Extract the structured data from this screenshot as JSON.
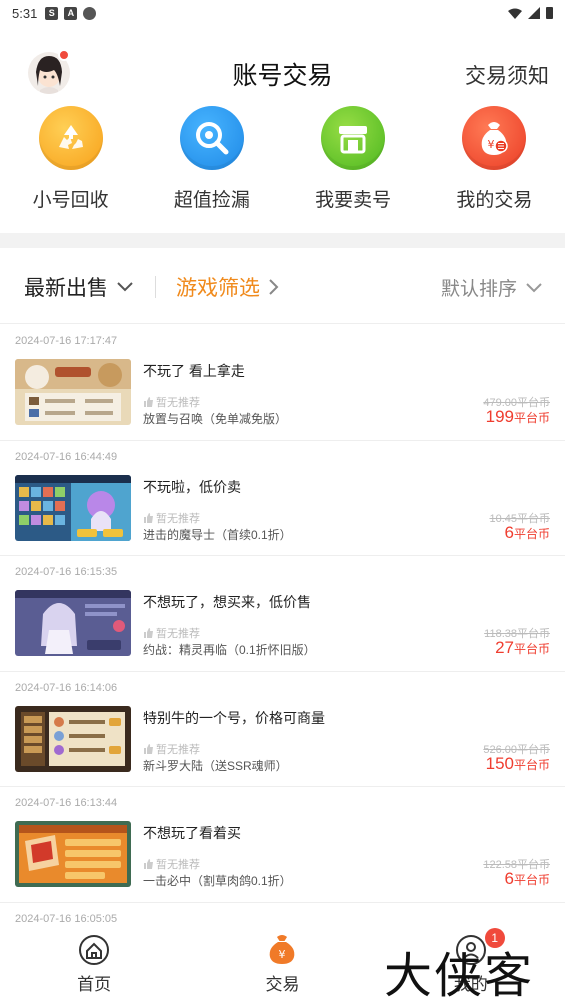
{
  "status_bar": {
    "time": "5:31",
    "icons": [
      "s-app-icon",
      "a-app-icon",
      "circle-icon"
    ],
    "right_icons": [
      "wifi-icon",
      "signal-icon",
      "battery-icon"
    ]
  },
  "header": {
    "title": "账号交易",
    "notice_link": "交易须知"
  },
  "quick_menu": [
    {
      "label": "小号回收",
      "icon": "recycle-icon",
      "color": "#f7a019"
    },
    {
      "label": "超值捡漏",
      "icon": "search-icon",
      "color": "#1e88e5"
    },
    {
      "label": "我要卖号",
      "icon": "shop-icon",
      "color": "#4cb71f"
    },
    {
      "label": "我的交易",
      "icon": "money-bag-icon",
      "color": "#ea3b24"
    }
  ],
  "filters": {
    "latest": "最新出售",
    "game_filter": "游戏筛选",
    "sort": "默认排序"
  },
  "listings": [
    {
      "time": "2024-07-16 17:17:47",
      "title": "不玩了 看上拿走",
      "no_recommend": "暂无推荐",
      "game": "放置与召唤（免单减免版）",
      "original_price": "479.00平台币",
      "price": "199",
      "unit": "平台币"
    },
    {
      "time": "2024-07-16 16:44:49",
      "title": "不玩啦，低价卖",
      "no_recommend": "暂无推荐",
      "game": "进击的魔导士（首续0.1折）",
      "original_price": "10.45平台币",
      "price": "6",
      "unit": "平台币"
    },
    {
      "time": "2024-07-16 16:15:35",
      "title": "不想玩了，想买来，低价售",
      "no_recommend": "暂无推荐",
      "game": "约战：精灵再临（0.1折怀旧版）",
      "original_price": "118.38平台币",
      "price": "27",
      "unit": "平台币"
    },
    {
      "time": "2024-07-16 16:14:06",
      "title": "特别牛的一个号，价格可商量",
      "no_recommend": "暂无推荐",
      "game": "新斗罗大陆（送SSR魂师）",
      "original_price": "526.00平台币",
      "price": "150",
      "unit": "平台币"
    },
    {
      "time": "2024-07-16 16:13:44",
      "title": "不想玩了看着买",
      "no_recommend": "暂无推荐",
      "game": "一击必中（割草肉鸽0.1折）",
      "original_price": "122.58平台币",
      "price": "6",
      "unit": "平台币"
    }
  ],
  "partial_listing_time": "2024-07-16 16:05:05",
  "bottom_nav": [
    {
      "label": "首页",
      "icon": "home-icon"
    },
    {
      "label": "交易",
      "icon": "money-bag-icon"
    },
    {
      "label": "我的",
      "icon": "profile-icon",
      "badge": "1"
    }
  ],
  "watermark": "大侠客",
  "colors": {
    "accent_orange": "#f08a1c",
    "price_red": "#ef3d2f",
    "band_gray": "#f2f2f2"
  }
}
